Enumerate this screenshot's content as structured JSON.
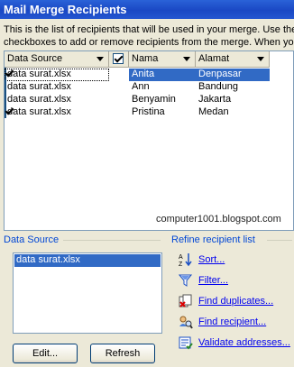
{
  "window": {
    "title": "Mail Merge Recipients"
  },
  "description": {
    "line1": "This is the list of recipients that will be used in your merge.  Use the",
    "line2": "checkboxes to add or remove recipients from the merge.  When you"
  },
  "grid": {
    "headers": {
      "data_source": "Data Source",
      "nama": "Nama",
      "alamat": "Alamat"
    },
    "rows": [
      {
        "source": "data surat.xlsx",
        "checked": true,
        "nama": "Anita",
        "alamat": "Denpasar",
        "selected": true
      },
      {
        "source": "data surat.xlsx",
        "checked": false,
        "nama": "Ann",
        "alamat": "Bandung"
      },
      {
        "source": "data surat.xlsx",
        "checked": false,
        "nama": "Benyamin",
        "alamat": "Jakarta"
      },
      {
        "source": "data surat.xlsx",
        "checked": true,
        "nama": "Pristina",
        "alamat": "Medan"
      }
    ],
    "watermark": "computer1001.blogspot.com"
  },
  "data_source_section": {
    "label": "Data Source",
    "items": [
      "data surat.xlsx"
    ],
    "edit_button": "Edit...",
    "refresh_button": "Refresh"
  },
  "refine_section": {
    "label": "Refine recipient list",
    "links": [
      {
        "label": "Sort...",
        "icon": "sort-az-icon"
      },
      {
        "label": "Filter...",
        "icon": "filter-funnel-icon"
      },
      {
        "label": "Find duplicates...",
        "icon": "find-duplicates-icon"
      },
      {
        "label": "Find recipient...",
        "icon": "find-recipient-icon"
      },
      {
        "label": "Validate addresses...",
        "icon": "validate-addresses-icon"
      }
    ]
  },
  "colors": {
    "selection": "#316ac5",
    "link": "#0000ee",
    "section_label": "#0046d5",
    "titlebar": "#1a48c4"
  }
}
